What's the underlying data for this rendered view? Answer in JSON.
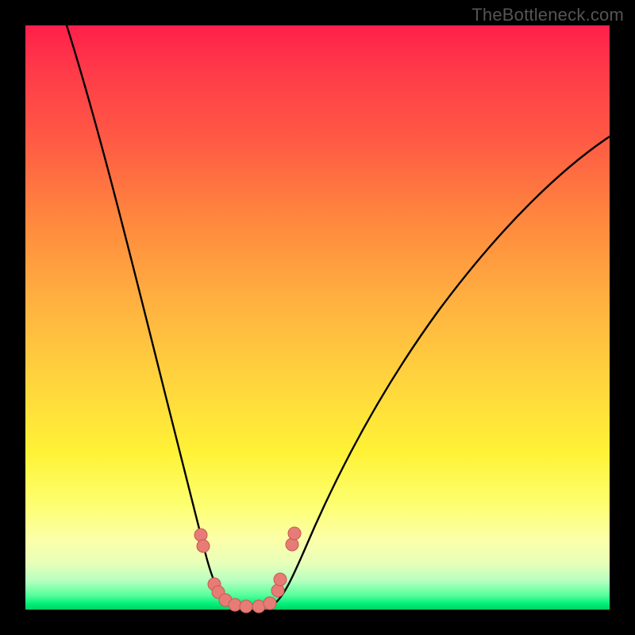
{
  "watermark": "TheBottleneck.com",
  "colors": {
    "background": "#000000",
    "gradient_top": "#ff1f4b",
    "gradient_mid": "#fff236",
    "gradient_bottom": "#00cf63",
    "curve": "#000000",
    "dots": "#e77b75"
  },
  "chart_data": {
    "type": "line",
    "title": "",
    "xlabel": "",
    "ylabel": "",
    "xlim": [
      0,
      100
    ],
    "ylim": [
      0,
      100
    ],
    "series": [
      {
        "name": "bottleneck-curve",
        "x": [
          0,
          4,
          8,
          12,
          16,
          20,
          24,
          26,
          28,
          30,
          31,
          32,
          33,
          34,
          35,
          37,
          39,
          41,
          44,
          48,
          54,
          62,
          72,
          84,
          96,
          100
        ],
        "y": [
          100,
          87,
          75,
          63,
          51,
          39,
          26,
          20,
          14,
          8,
          5,
          3,
          1.5,
          1,
          1,
          1,
          1.5,
          3,
          6,
          12,
          22,
          35,
          49,
          63,
          76,
          80
        ]
      }
    ],
    "markers": {
      "name": "highlight-dots",
      "x": [
        28,
        28.3,
        30,
        30.5,
        31.5,
        33,
        35,
        37,
        39,
        40,
        40.3,
        42,
        42.3
      ],
      "y": [
        13,
        11,
        4.5,
        3,
        1.5,
        1,
        1,
        1,
        1.5,
        4,
        6,
        12,
        14
      ]
    }
  }
}
